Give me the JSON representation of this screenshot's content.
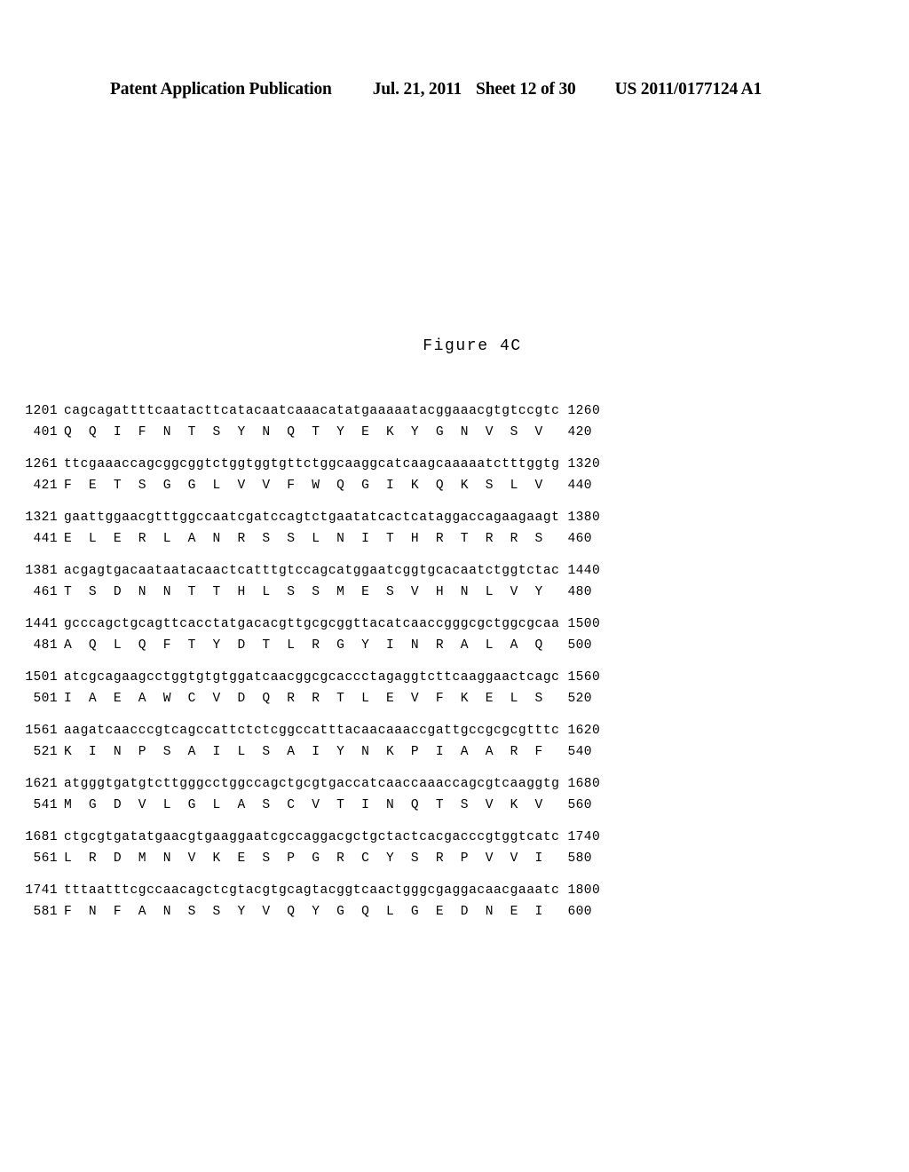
{
  "header": {
    "publication": "Patent Application Publication",
    "date": "Jul. 21, 2011",
    "sheet": "Sheet 12 of 30",
    "patent_number": "US 2011/0177124 A1"
  },
  "figure": {
    "caption": "Figure 4C"
  },
  "sequence": {
    "blocks": [
      {
        "nuc_start": "1201",
        "nucleotides": "cagcagattttcaatacttcatacaatcaaacatatgaaaaatacggaaacgtgtccgtc",
        "nuc_end": "1260",
        "prot_start": "401",
        "amino_acids": "Q  Q  I  F  N  T  S  Y  N  Q  T  Y  E  K  Y  G  N  V  S  V",
        "prot_end": "420"
      },
      {
        "nuc_start": "1261",
        "nucleotides": "ttcgaaaccagcggcggtctggtggtgttctggcaaggcatcaagcaaaaatctttggtg",
        "nuc_end": "1320",
        "prot_start": "421",
        "amino_acids": "F  E  T  S  G  G  L  V  V  F  W  Q  G  I  K  Q  K  S  L  V",
        "prot_end": "440"
      },
      {
        "nuc_start": "1321",
        "nucleotides": "gaattggaacgtttggccaatcgatccagtctgaatatcactcataggaccagaagaagt",
        "nuc_end": "1380",
        "prot_start": "441",
        "amino_acids": "E  L  E  R  L  A  N  R  S  S  L  N  I  T  H  R  T  R  R  S",
        "prot_end": "460"
      },
      {
        "nuc_start": "1381",
        "nucleotides": "acgagtgacaataatacaactcatttgtccagcatggaatcggtgcacaatctggtctac",
        "nuc_end": "1440",
        "prot_start": "461",
        "amino_acids": "T  S  D  N  N  T  T  H  L  S  S  M  E  S  V  H  N  L  V  Y",
        "prot_end": "480"
      },
      {
        "nuc_start": "1441",
        "nucleotides": "gcccagctgcagttcacctatgacacgttgcgcggttacatcaaccgggcgctggcgcaa",
        "nuc_end": "1500",
        "prot_start": "481",
        "amino_acids": "A  Q  L  Q  F  T  Y  D  T  L  R  G  Y  I  N  R  A  L  A  Q",
        "prot_end": "500"
      },
      {
        "nuc_start": "1501",
        "nucleotides": "atcgcagaagcctggtgtgtggatcaacggcgcaccctagaggtcttcaaggaactcagc",
        "nuc_end": "1560",
        "prot_start": "501",
        "amino_acids": "I  A  E  A  W  C  V  D  Q  R  R  T  L  E  V  F  K  E  L  S",
        "prot_end": "520"
      },
      {
        "nuc_start": "1561",
        "nucleotides": "aagatcaacccgtcagccattctctcggccatttacaacaaaccgattgccgcgcgtttc",
        "nuc_end": "1620",
        "prot_start": "521",
        "amino_acids": "K  I  N  P  S  A  I  L  S  A  I  Y  N  K  P  I  A  A  R  F",
        "prot_end": "540"
      },
      {
        "nuc_start": "1621",
        "nucleotides": "atgggtgatgtcttgggcctggccagctgcgtgaccatcaaccaaaccagcgtcaaggtg",
        "nuc_end": "1680",
        "prot_start": "541",
        "amino_acids": "M  G  D  V  L  G  L  A  S  C  V  T  I  N  Q  T  S  V  K  V",
        "prot_end": "560"
      },
      {
        "nuc_start": "1681",
        "nucleotides": "ctgcgtgatatgaacgtgaaggaatcgccaggacgctgctactcacgacccgtggtcatc",
        "nuc_end": "1740",
        "prot_start": "561",
        "amino_acids": "L  R  D  M  N  V  K  E  S  P  G  R  C  Y  S  R  P  V  V  I",
        "prot_end": "580"
      },
      {
        "nuc_start": "1741",
        "nucleotides": "tttaatttcgccaacagctcgtacgtgcagtacggtcaactgggcgaggacaacgaaatc",
        "nuc_end": "1800",
        "prot_start": "581",
        "amino_acids": "F  N  F  A  N  S  S  Y  V  Q  Y  G  Q  L  G  E  D  N  E  I",
        "prot_end": "600"
      }
    ]
  }
}
